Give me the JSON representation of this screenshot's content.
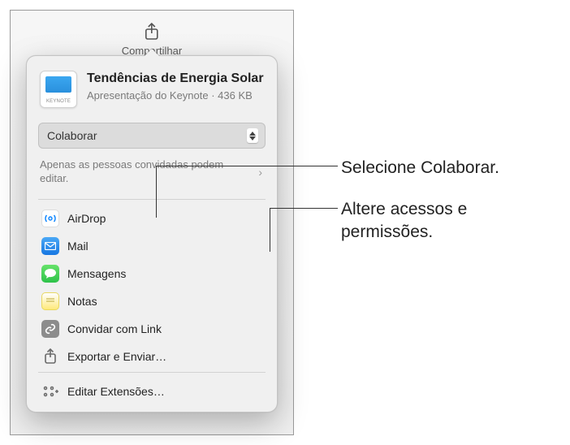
{
  "toolbar": {
    "share_label": "Compartilhar"
  },
  "document": {
    "title": "Tendências de Energia Solar",
    "subtitle": "Apresentação do Keynote · 436 KB",
    "thumb_label": "KEYNOTE"
  },
  "mode_select": {
    "value": "Colaborar"
  },
  "permissions": {
    "text": "Apenas as pessoas convidadas podem editar."
  },
  "share_targets": [
    {
      "label": "AirDrop",
      "icon": "airdrop"
    },
    {
      "label": "Mail",
      "icon": "mail"
    },
    {
      "label": "Mensagens",
      "icon": "messages"
    },
    {
      "label": "Notas",
      "icon": "notes"
    },
    {
      "label": "Convidar com Link",
      "icon": "link"
    },
    {
      "label": "Exportar e Enviar…",
      "icon": "export"
    }
  ],
  "edit_extensions": {
    "label": "Editar Extensões…"
  },
  "callouts": {
    "c1": "Selecione Colaborar.",
    "c2": "Altere acessos e permissões."
  }
}
